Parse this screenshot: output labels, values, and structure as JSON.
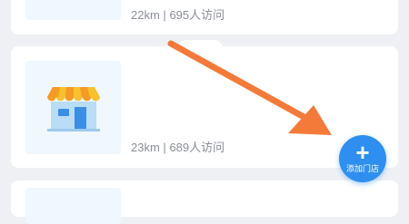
{
  "stores": [
    {
      "distance": "22km",
      "visits": "695人访问"
    },
    {
      "distance": "23km",
      "visits": "689人访问"
    },
    {
      "distance": "",
      "visits": ""
    }
  ],
  "separator": "|",
  "fab": {
    "label": "添加门店",
    "icon": "plus-icon"
  },
  "annotation": {
    "color": "#f47a3a",
    "icon": "arrow-annotation"
  }
}
